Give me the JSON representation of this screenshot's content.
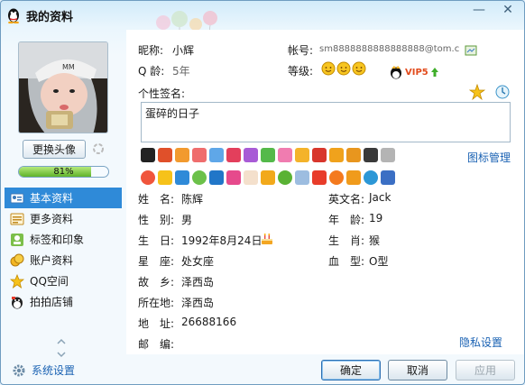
{
  "window": {
    "title": "我的资料",
    "minimize_glyph": "—",
    "close_glyph": "✕"
  },
  "profile": {
    "nickname_label": "昵称:",
    "nickname": "小辉",
    "account_label": "帐号:",
    "account": "sm8888888888888888@tom.c",
    "qage_label": "Q 龄:",
    "qage": "5年",
    "level_label": "等级:",
    "vip_text": "VIP5",
    "signature_label": "个性签名:",
    "signature": "蛋碎的日子",
    "change_avatar": "更换头像",
    "completion": "81%",
    "completion_fraction": 0.81,
    "icon_manage": "图标管理"
  },
  "nav": {
    "items": [
      {
        "label": "基本资料",
        "icon": "profile-card-icon",
        "active": true
      },
      {
        "label": "更多资料",
        "icon": "more-info-icon",
        "active": false
      },
      {
        "label": "标签和印象",
        "icon": "tag-icon",
        "active": false
      },
      {
        "label": "账户资料",
        "icon": "coins-icon",
        "active": false
      },
      {
        "label": "QQ空间",
        "icon": "star-icon",
        "active": false
      },
      {
        "label": "拍拍店铺",
        "icon": "shop-icon",
        "active": false
      }
    ]
  },
  "details": {
    "name_label": "姓　名:",
    "name": "陈辉",
    "gender_label": "性　别:",
    "gender": "男",
    "birthday_label": "生　日:",
    "birthday": "1992年8月24日",
    "constellation_label": "星　座:",
    "constellation": "处女座",
    "hometown_label": "故　乡:",
    "hometown": "泽西岛",
    "location_label": "所在地:",
    "location": "泽西岛",
    "address_label": "地　址:",
    "address": "26688166",
    "postcode_label": "邮　编:",
    "postcode": "",
    "english_name_label": "英文名:",
    "english_name": "Jack",
    "age_label": "年　龄:",
    "age": "19",
    "zodiac_label": "生　肖:",
    "zodiac": "猴",
    "blood_label": "血　型:",
    "blood": "O型",
    "privacy_link": "隐私设置"
  },
  "footer": {
    "settings": "系统设置",
    "ok": "确定",
    "cancel": "取消",
    "apply": "应用"
  },
  "colors": {
    "accent": "#2f8ad8",
    "link": "#1a62b3",
    "progress": "#5fb32a",
    "vip": "#e24b1c"
  }
}
